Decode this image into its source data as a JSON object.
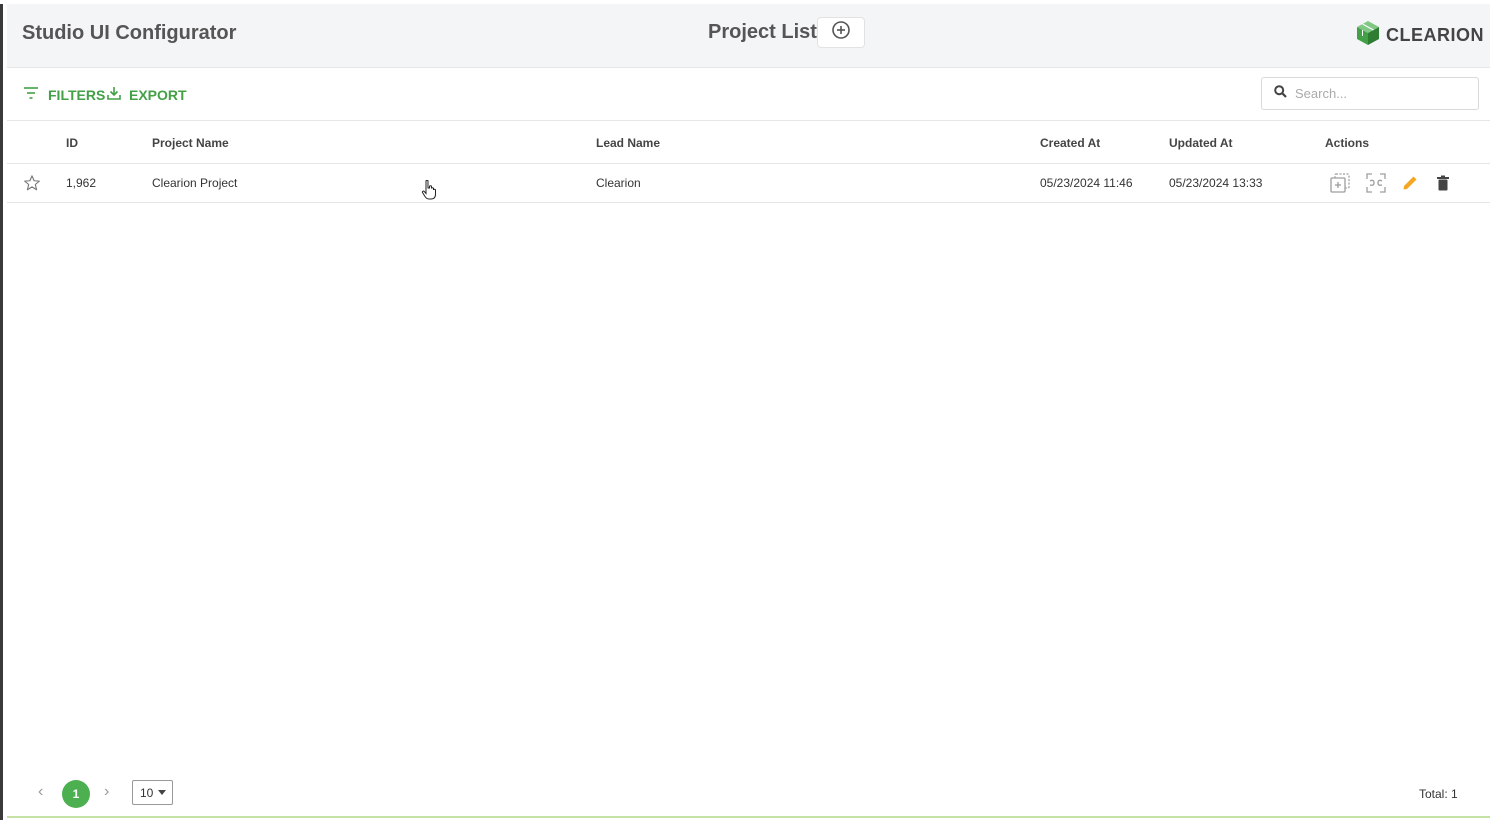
{
  "header": {
    "app_title": "Studio UI Configurator",
    "page_title": "Project List",
    "add_icon": "plus-circle-icon",
    "logo_text": "CLEARION",
    "logo_icon": "cube-logo-icon"
  },
  "toolbar": {
    "filters_label": "FILTERS",
    "export_label": "EXPORT",
    "search_placeholder": "Search...",
    "search_value": ""
  },
  "table": {
    "columns": {
      "id": "ID",
      "project_name": "Project Name",
      "lead_name": "Lead Name",
      "created_at": "Created At",
      "updated_at": "Updated At",
      "actions": "Actions"
    },
    "rows": [
      {
        "favorite": false,
        "id": "1,962",
        "project_name": "Clearion Project",
        "lead_name": "Clearion",
        "created_at": "05/23/2024 11:46",
        "updated_at": "05/23/2024 13:33",
        "actions": [
          "copy-icon",
          "compare-icon",
          "edit-icon",
          "delete-icon"
        ]
      }
    ]
  },
  "pagination": {
    "current_page": "1",
    "page_size": "10",
    "total_label": "Total: 1"
  },
  "colors": {
    "accent": "#43a047",
    "edit": "#f5a623",
    "delete": "#444444"
  }
}
